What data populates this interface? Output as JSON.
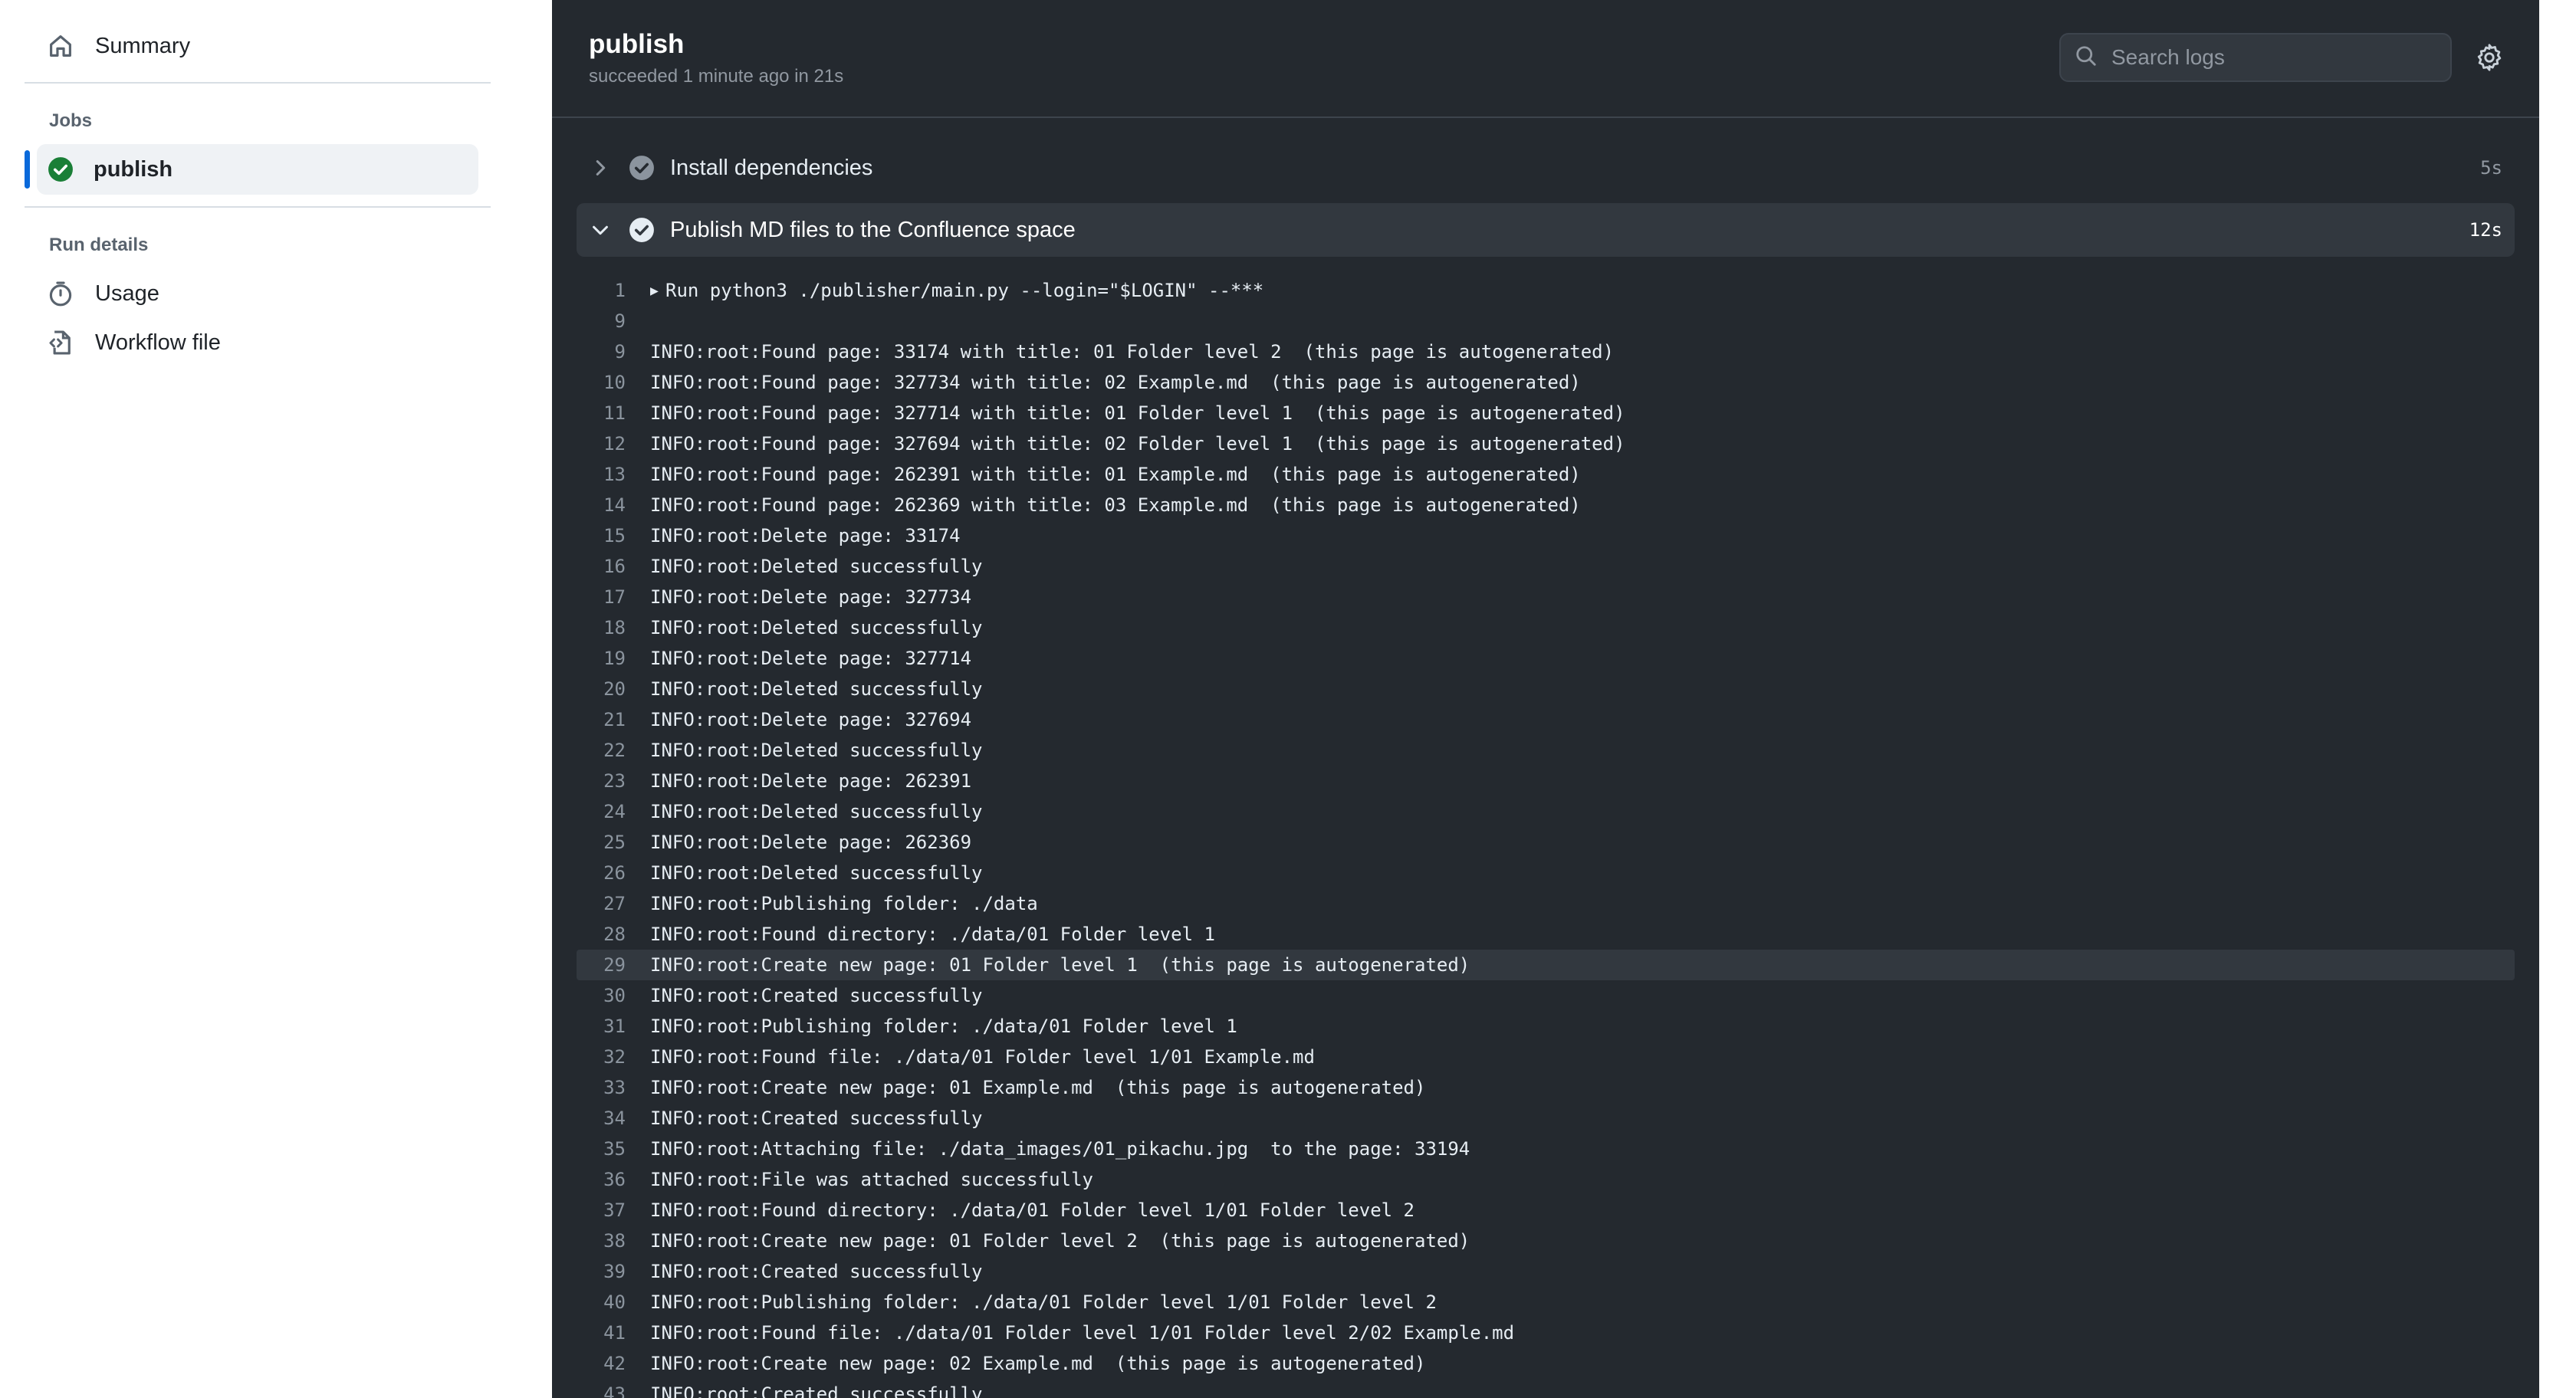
{
  "sidebar": {
    "summary_label": "Summary",
    "jobs_heading": "Jobs",
    "job_label": "publish",
    "run_details_heading": "Run details",
    "usage_label": "Usage",
    "workflow_file_label": "Workflow file"
  },
  "header": {
    "title": "publish",
    "subtitle": "succeeded 1 minute ago in 21s",
    "search_placeholder": "Search logs"
  },
  "steps": [
    {
      "name": "Install dependencies",
      "duration": "5s",
      "expanded": false
    },
    {
      "name": "Publish MD files to the Confluence space",
      "duration": "12s",
      "expanded": true
    }
  ],
  "log_lines": [
    {
      "n": "1",
      "text": "Run python3 ./publisher/main.py --login=\"$LOGIN\" --***",
      "collapsible": true
    },
    {
      "n": "9",
      "text": ""
    },
    {
      "n": "9",
      "text": "INFO:root:Found page: 33174 with title: 01 Folder level 2  (this page is autogenerated)"
    },
    {
      "n": "10",
      "text": "INFO:root:Found page: 327734 with title: 02 Example.md  (this page is autogenerated)"
    },
    {
      "n": "11",
      "text": "INFO:root:Found page: 327714 with title: 01 Folder level 1  (this page is autogenerated)"
    },
    {
      "n": "12",
      "text": "INFO:root:Found page: 327694 with title: 02 Folder level 1  (this page is autogenerated)"
    },
    {
      "n": "13",
      "text": "INFO:root:Found page: 262391 with title: 01 Example.md  (this page is autogenerated)"
    },
    {
      "n": "14",
      "text": "INFO:root:Found page: 262369 with title: 03 Example.md  (this page is autogenerated)"
    },
    {
      "n": "15",
      "text": "INFO:root:Delete page: 33174"
    },
    {
      "n": "16",
      "text": "INFO:root:Deleted successfully"
    },
    {
      "n": "17",
      "text": "INFO:root:Delete page: 327734"
    },
    {
      "n": "18",
      "text": "INFO:root:Deleted successfully"
    },
    {
      "n": "19",
      "text": "INFO:root:Delete page: 327714"
    },
    {
      "n": "20",
      "text": "INFO:root:Deleted successfully"
    },
    {
      "n": "21",
      "text": "INFO:root:Delete page: 327694"
    },
    {
      "n": "22",
      "text": "INFO:root:Deleted successfully"
    },
    {
      "n": "23",
      "text": "INFO:root:Delete page: 262391"
    },
    {
      "n": "24",
      "text": "INFO:root:Deleted successfully"
    },
    {
      "n": "25",
      "text": "INFO:root:Delete page: 262369"
    },
    {
      "n": "26",
      "text": "INFO:root:Deleted successfully"
    },
    {
      "n": "27",
      "text": "INFO:root:Publishing folder: ./data"
    },
    {
      "n": "28",
      "text": "INFO:root:Found directory: ./data/01 Folder level 1"
    },
    {
      "n": "29",
      "text": "INFO:root:Create new page: 01 Folder level 1  (this page is autogenerated)",
      "highlighted": true
    },
    {
      "n": "30",
      "text": "INFO:root:Created successfully"
    },
    {
      "n": "31",
      "text": "INFO:root:Publishing folder: ./data/01 Folder level 1"
    },
    {
      "n": "32",
      "text": "INFO:root:Found file: ./data/01 Folder level 1/01 Example.md"
    },
    {
      "n": "33",
      "text": "INFO:root:Create new page: 01 Example.md  (this page is autogenerated)"
    },
    {
      "n": "34",
      "text": "INFO:root:Created successfully"
    },
    {
      "n": "35",
      "text": "INFO:root:Attaching file: ./data_images/01_pikachu.jpg  to the page: 33194"
    },
    {
      "n": "36",
      "text": "INFO:root:File was attached successfully"
    },
    {
      "n": "37",
      "text": "INFO:root:Found directory: ./data/01 Folder level 1/01 Folder level 2"
    },
    {
      "n": "38",
      "text": "INFO:root:Create new page: 01 Folder level 2  (this page is autogenerated)"
    },
    {
      "n": "39",
      "text": "INFO:root:Created successfully"
    },
    {
      "n": "40",
      "text": "INFO:root:Publishing folder: ./data/01 Folder level 1/01 Folder level 2"
    },
    {
      "n": "41",
      "text": "INFO:root:Found file: ./data/01 Folder level 1/01 Folder level 2/02 Example.md"
    },
    {
      "n": "42",
      "text": "INFO:root:Create new page: 02 Example.md  (this page is autogenerated)"
    },
    {
      "n": "43",
      "text": "INFO:root:Created successfully"
    }
  ],
  "icons": {
    "summary": "home-icon",
    "job_status": "check-circle-icon",
    "usage": "stopwatch-icon",
    "workflow_file": "file-code-icon",
    "search": "search-icon",
    "settings": "gear-icon"
  },
  "colors": {
    "success": "#1a7f37",
    "accent": "#0969da",
    "log_background": "#24292f"
  }
}
